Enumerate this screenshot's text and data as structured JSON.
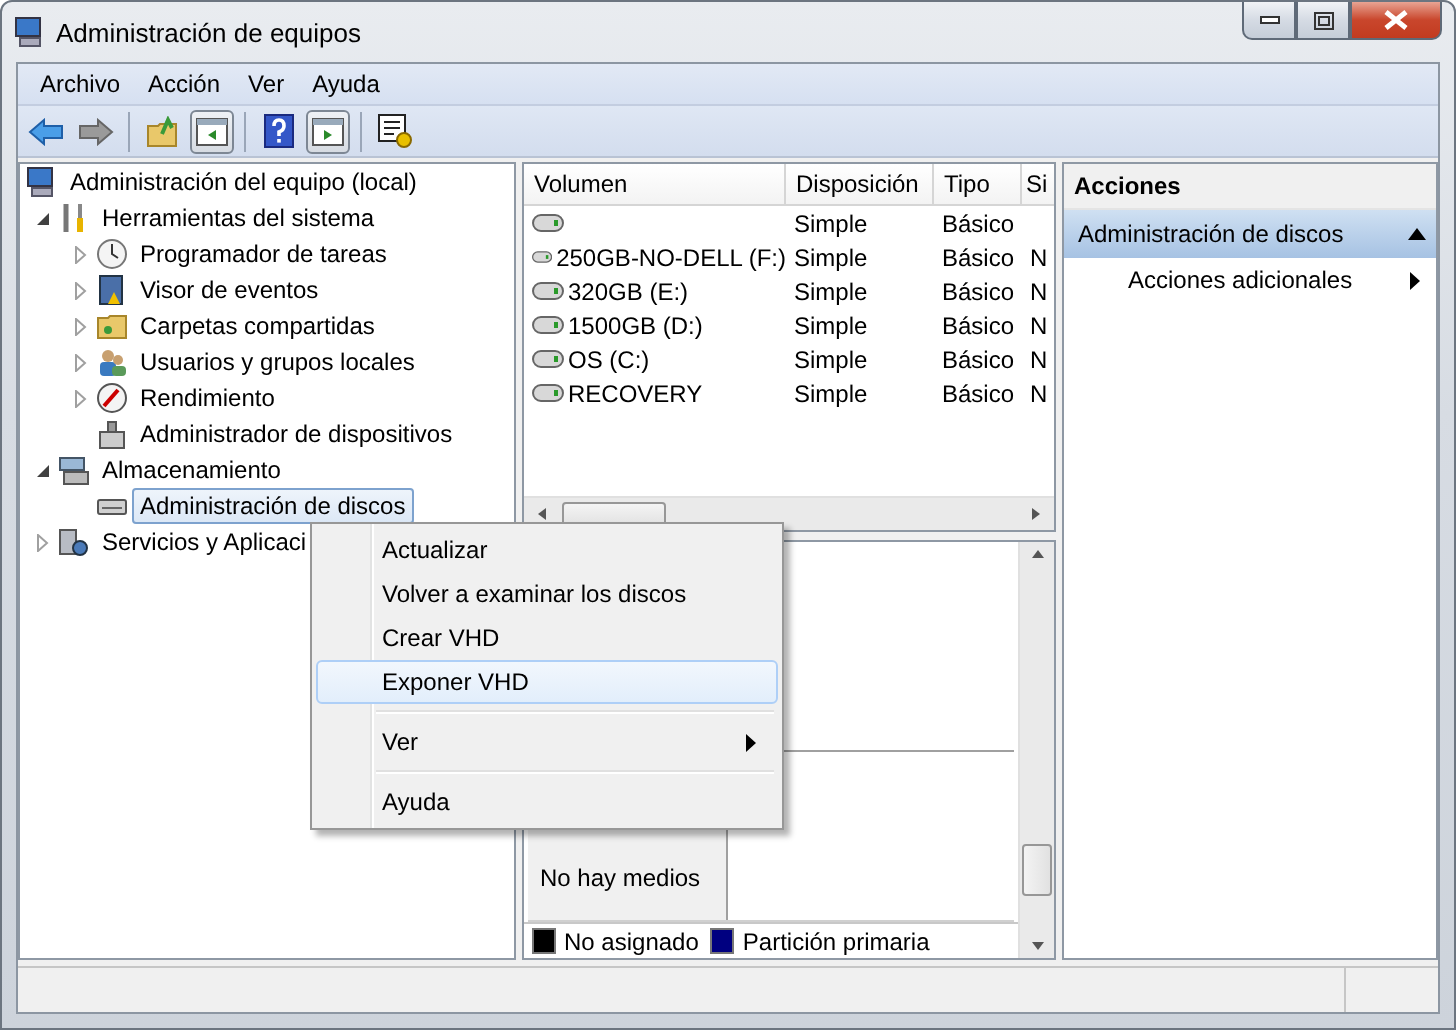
{
  "window": {
    "title": "Administración de equipos"
  },
  "menu_bar": [
    "Archivo",
    "Acción",
    "Ver",
    "Ayuda"
  ],
  "tree": [
    {
      "label": "Administración del equipo (local)",
      "selected": false,
      "children": [
        {
          "label": "Herramientas del sistema",
          "expanded": true,
          "selected": false,
          "children": [
            {
              "label": "Programador de tareas",
              "expanded": false,
              "selected": false
            },
            {
              "label": "Visor de eventos",
              "expanded": false,
              "selected": false
            },
            {
              "label": "Carpetas compartidas",
              "expanded": false,
              "selected": false
            },
            {
              "label": "Usuarios y grupos locales",
              "expanded": false,
              "selected": false
            },
            {
              "label": "Rendimiento",
              "expanded": false,
              "selected": false
            },
            {
              "label": "Administrador de dispositivos",
              "selected": false
            }
          ]
        },
        {
          "label": "Almacenamiento",
          "expanded": true,
          "selected": false,
          "children": [
            {
              "label": "Administración de discos",
              "selected": true
            }
          ]
        },
        {
          "label": "Servicios y Aplicaci",
          "expanded": false,
          "selected": false
        }
      ]
    }
  ],
  "table": {
    "columns": [
      "Volumen",
      "Disposición",
      "Tipo",
      "Si"
    ],
    "rows": [
      {
        "disposicion": "Simple",
        "tipo": "Básico"
      },
      {
        "volumen": "250GB-NO-DELL (F:)",
        "disposicion": "Simple",
        "tipo": "Básico",
        "column_4": "N"
      },
      {
        "volumen": "320GB (E:)",
        "disposicion": "Simple",
        "tipo": "Básico",
        "column_4": "N"
      },
      {
        "volumen": "1500GB (D:)",
        "disposicion": "Simple",
        "tipo": "Básico",
        "column_4": "N"
      },
      {
        "volumen": "OS (C:)",
        "disposicion": "Simple",
        "tipo": "Básico",
        "column_4": "N"
      },
      {
        "volumen": "RECOVERY",
        "disposicion": "Simple",
        "tipo": "Básico",
        "column_4": "N"
      }
    ]
  },
  "disk_view": {
    "disks": [
      {
        "status": "No hay medios"
      }
    ],
    "legend": [
      {
        "label": "No asignado",
        "color": "#000000"
      },
      {
        "label": "Partición primaria",
        "color": "#000080"
      }
    ]
  },
  "actions": {
    "title": "Acciones",
    "sections": [
      {
        "label": "Administración de discos",
        "expanded": true,
        "items": [
          "Acciones adicionales"
        ]
      }
    ]
  },
  "context_menu": {
    "items": [
      {
        "kind": "command",
        "label": "Actualizar",
        "selected": false
      },
      {
        "kind": "command",
        "label": "Volver a examinar los discos",
        "selected": false
      },
      {
        "kind": "command",
        "label": "Crear VHD",
        "selected": false
      },
      {
        "kind": "command",
        "label": "Exponer VHD",
        "selected": true
      },
      {
        "kind": "separator"
      },
      {
        "kind": "submenu",
        "label": "Ver",
        "selected": false
      },
      {
        "kind": "separator"
      },
      {
        "kind": "command",
        "label": "Ayuda",
        "selected": false
      }
    ]
  }
}
